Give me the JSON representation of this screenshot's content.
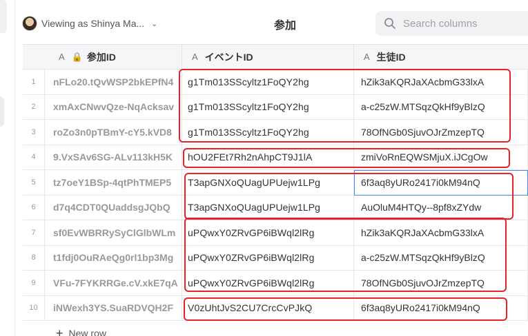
{
  "topbar": {
    "viewing_as": "Viewing as Shinya Ma...",
    "page_title": "参加",
    "search_placeholder": "Search columns"
  },
  "columns": {
    "id": {
      "type_icon": "A",
      "label": "参加ID"
    },
    "event": {
      "type_icon": "A",
      "label": "イベントID"
    },
    "student": {
      "type_icon": "A",
      "label": "生徒ID"
    }
  },
  "rows": [
    {
      "num": "1",
      "id": "nFLo20.tQvWSP2bkEPfN4",
      "event": "g1Tm013SScyltz1FoQY2hg",
      "student": "hZik3aKQRJaXAcbmG33lxA"
    },
    {
      "num": "2",
      "id": "xmAxCNwvQze-NqAcksav",
      "event": "g1Tm013SScyltz1FoQY2hg",
      "student": "a-c25zW.MTSqzQkHf9yBlzQ"
    },
    {
      "num": "3",
      "id": "roZo3n0pTBmY-cY5.kVD8",
      "event": "g1Tm013SScyltz1FoQY2hg",
      "student": "78OfNGb0SjuvOJrZmzepTQ"
    },
    {
      "num": "4",
      "id": "9.VxSAv6SG-ALv113kH5K",
      "event": "hOU2FEt7Rh2nAhpCT9J1lA",
      "student": "zmiVoRnEQWSMjuX.iJCgOw"
    },
    {
      "num": "5",
      "id": "tz7oeY1BSp-4qtPhTMEP5",
      "event": "T3apGNXoQUagUPUejw1LPg",
      "student": "6f3aq8yURo2417i0kM94nQ"
    },
    {
      "num": "6",
      "id": "d7q4CDT0QUaddsgJQbQ",
      "event": "T3apGNXoQUagUPUejw1LPg",
      "student": "AuOluM4HTQy--8pf8xZYdw"
    },
    {
      "num": "7",
      "id": "sf0EvWBRRySyClGlbWLm",
      "event": "uPQwxY0ZRvGP6iBWql2lRg",
      "student": "hZik3aKQRJaXAcbmG33lxA"
    },
    {
      "num": "8",
      "id": "t1fdj0OuRAeQg0rl1bp3Mg",
      "event": "uPQwxY0ZRvGP6iBWql2lRg",
      "student": "a-c25zW.MTSqzQkHf9yBlzQ"
    },
    {
      "num": "9",
      "id": "VFu-7FYKRRGe.cV.xkE7qA",
      "event": "uPQwxY0ZRvGP6iBWql2lRg",
      "student": "78OfNGb0SjuvOJrZmzepTQ"
    },
    {
      "num": "10",
      "id": "iNWexh3YS.SuaRDVQH2F",
      "event": "V0zUhtJvS2CU7CrcCvPJkQ",
      "student": "6f3aq8yURo2417i0kM94nQ"
    }
  ],
  "new_row_label": "New row",
  "icons": {
    "search": "search-icon",
    "chevron": "chevron-down-icon",
    "lock": "lock-icon",
    "plus": "plus-icon"
  },
  "colors": {
    "highlight": "#e8202a",
    "selection": "#4a86e8"
  }
}
